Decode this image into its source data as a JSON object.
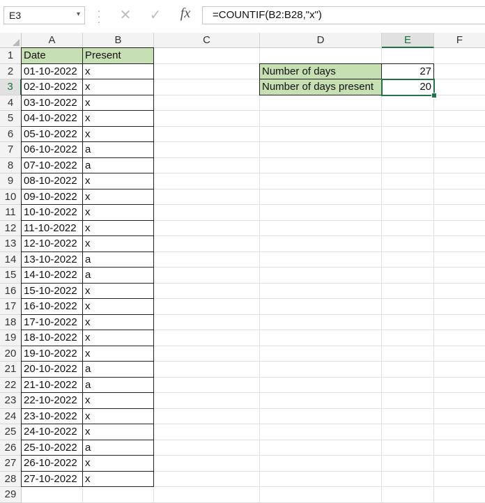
{
  "formula_bar": {
    "name_box": "E3",
    "formula": "=COUNTIF(B2:B28,\"x\")",
    "fx_label": "fx"
  },
  "columns": [
    "A",
    "B",
    "C",
    "D",
    "E",
    "F"
  ],
  "rows": [
    "1",
    "2",
    "3",
    "4",
    "5",
    "6",
    "7",
    "8",
    "9",
    "10",
    "11",
    "12",
    "13",
    "14",
    "15",
    "16",
    "17",
    "18",
    "19",
    "20",
    "21",
    "22",
    "23",
    "24",
    "25",
    "26",
    "27",
    "28",
    "29"
  ],
  "table": {
    "headers": [
      "Date",
      "Present"
    ],
    "records": [
      [
        "01-10-2022",
        "x"
      ],
      [
        "02-10-2022",
        "x"
      ],
      [
        "03-10-2022",
        "x"
      ],
      [
        "04-10-2022",
        "x"
      ],
      [
        "05-10-2022",
        "x"
      ],
      [
        "06-10-2022",
        "a"
      ],
      [
        "07-10-2022",
        "a"
      ],
      [
        "08-10-2022",
        "x"
      ],
      [
        "09-10-2022",
        "x"
      ],
      [
        "10-10-2022",
        "x"
      ],
      [
        "11-10-2022",
        "x"
      ],
      [
        "12-10-2022",
        "x"
      ],
      [
        "13-10-2022",
        "a"
      ],
      [
        "14-10-2022",
        "a"
      ],
      [
        "15-10-2022",
        "x"
      ],
      [
        "16-10-2022",
        "x"
      ],
      [
        "17-10-2022",
        "x"
      ],
      [
        "18-10-2022",
        "x"
      ],
      [
        "19-10-2022",
        "x"
      ],
      [
        "20-10-2022",
        "a"
      ],
      [
        "21-10-2022",
        "a"
      ],
      [
        "22-10-2022",
        "x"
      ],
      [
        "23-10-2022",
        "x"
      ],
      [
        "24-10-2022",
        "x"
      ],
      [
        "25-10-2022",
        "a"
      ],
      [
        "26-10-2022",
        "x"
      ],
      [
        "27-10-2022",
        "x"
      ]
    ]
  },
  "summary": [
    {
      "label": "Number of days",
      "value": "27"
    },
    {
      "label": "Number of days present",
      "value": "20"
    }
  ],
  "selected_cell": "E3",
  "colors": {
    "header_fill": "#c6e0b4",
    "selection": "#217346"
  }
}
